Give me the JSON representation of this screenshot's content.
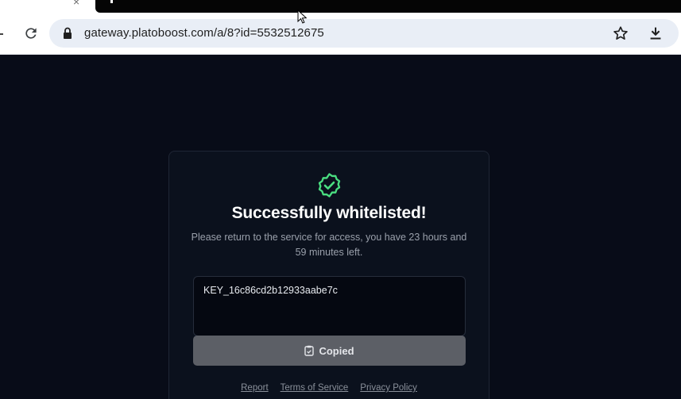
{
  "browser": {
    "tab_close_glyph": "×",
    "url": "gateway.platoboost.com/a/8?id=5532512675"
  },
  "page": {
    "title": "Successfully whitelisted!",
    "subtitle": "Please return to the service for access, you have 23 hours and 59 minutes left.",
    "key_value": "KEY_16c86cd2b12933aabe7c",
    "copied_label": "Copied",
    "footer_links": [
      "Report",
      "Terms of Service",
      "Privacy Policy"
    ]
  },
  "icons": {
    "verified": "verified-badge-icon",
    "clipboard": "clipboard-icon",
    "reload": "reload-icon",
    "lock": "lock-icon",
    "star": "star-icon",
    "download": "download-icon"
  },
  "colors": {
    "page_bg": "#080c18",
    "accent_green": "#4ade80",
    "button_bg": "#5c5f66"
  }
}
